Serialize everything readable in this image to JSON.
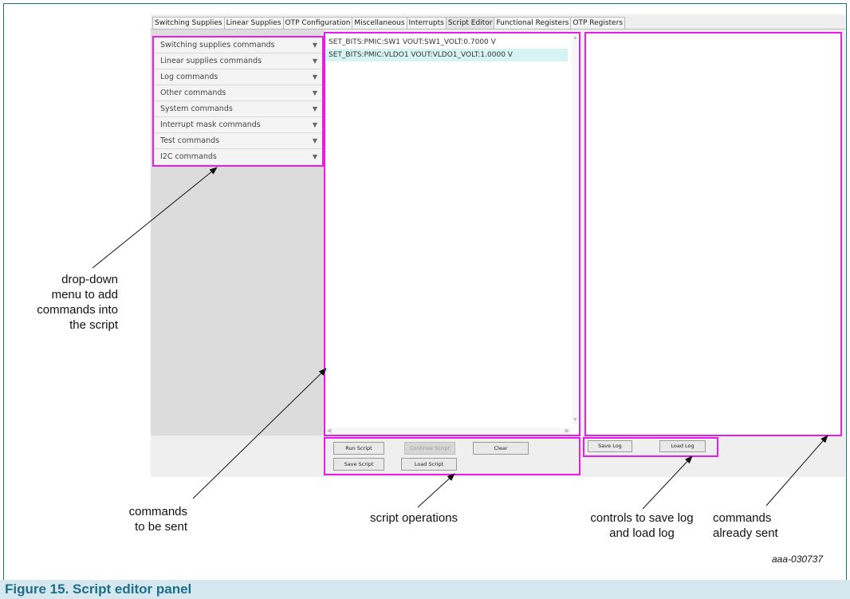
{
  "tabs": [
    {
      "label": "Switching Supplies",
      "active": false
    },
    {
      "label": "Linear Supplies",
      "active": false
    },
    {
      "label": "OTP Configuration",
      "active": false
    },
    {
      "label": "Miscellaneous",
      "active": false
    },
    {
      "label": "Interrupts",
      "active": false
    },
    {
      "label": "Script Editor",
      "active": true
    },
    {
      "label": "Functional Registers",
      "active": false
    },
    {
      "label": "OTP Registers",
      "active": false
    }
  ],
  "command_menu": {
    "items": [
      {
        "label": "Switching supplies commands",
        "icon": "chevron-down-icon"
      },
      {
        "label": "Linear supplies commands",
        "icon": "chevron-down-icon"
      },
      {
        "label": "Log commands",
        "icon": "chevron-down-icon"
      },
      {
        "label": "Other commands",
        "icon": "chevron-down-icon"
      },
      {
        "label": "System commands",
        "icon": "chevron-down-icon"
      },
      {
        "label": "Interrupt mask commands",
        "icon": "chevron-down-icon"
      },
      {
        "label": "Test commands",
        "icon": "chevron-down-icon"
      },
      {
        "label": "I2C commands",
        "icon": "chevron-down-icon"
      }
    ]
  },
  "script": {
    "lines": [
      {
        "text": "SET_BITS:PMIC:SW1 VOUT:SW1_VOLT:0.7000 V",
        "selected": false
      },
      {
        "text": "SET_BITS:PMIC:VLDO1 VOUT:VLDO1_VOLT:1.0000 V",
        "selected": true
      }
    ]
  },
  "script_operations": {
    "run": "Run Script",
    "continue": "Continue Script",
    "clear": "Clear",
    "save": "Save Script",
    "load": "Load Script"
  },
  "log_operations": {
    "save": "Save Log",
    "load": "Load Log"
  },
  "annotations": {
    "dropdown": [
      "drop-down",
      "menu to add",
      "commands into",
      "the script"
    ],
    "commands_to_send": [
      "commands",
      "to be sent"
    ],
    "script_ops": "script operations",
    "log_controls": [
      "controls to save log",
      "and load log"
    ],
    "commands_sent": [
      "commands",
      "already sent"
    ]
  },
  "figure_code": "aaa-030737",
  "caption": "Figure 15.  Script editor panel",
  "colors": {
    "highlight": "#e81ce8",
    "caption_bg": "#d6e8ef",
    "caption_text": "#1e6e88",
    "selected_row": "#d7f4f4"
  }
}
